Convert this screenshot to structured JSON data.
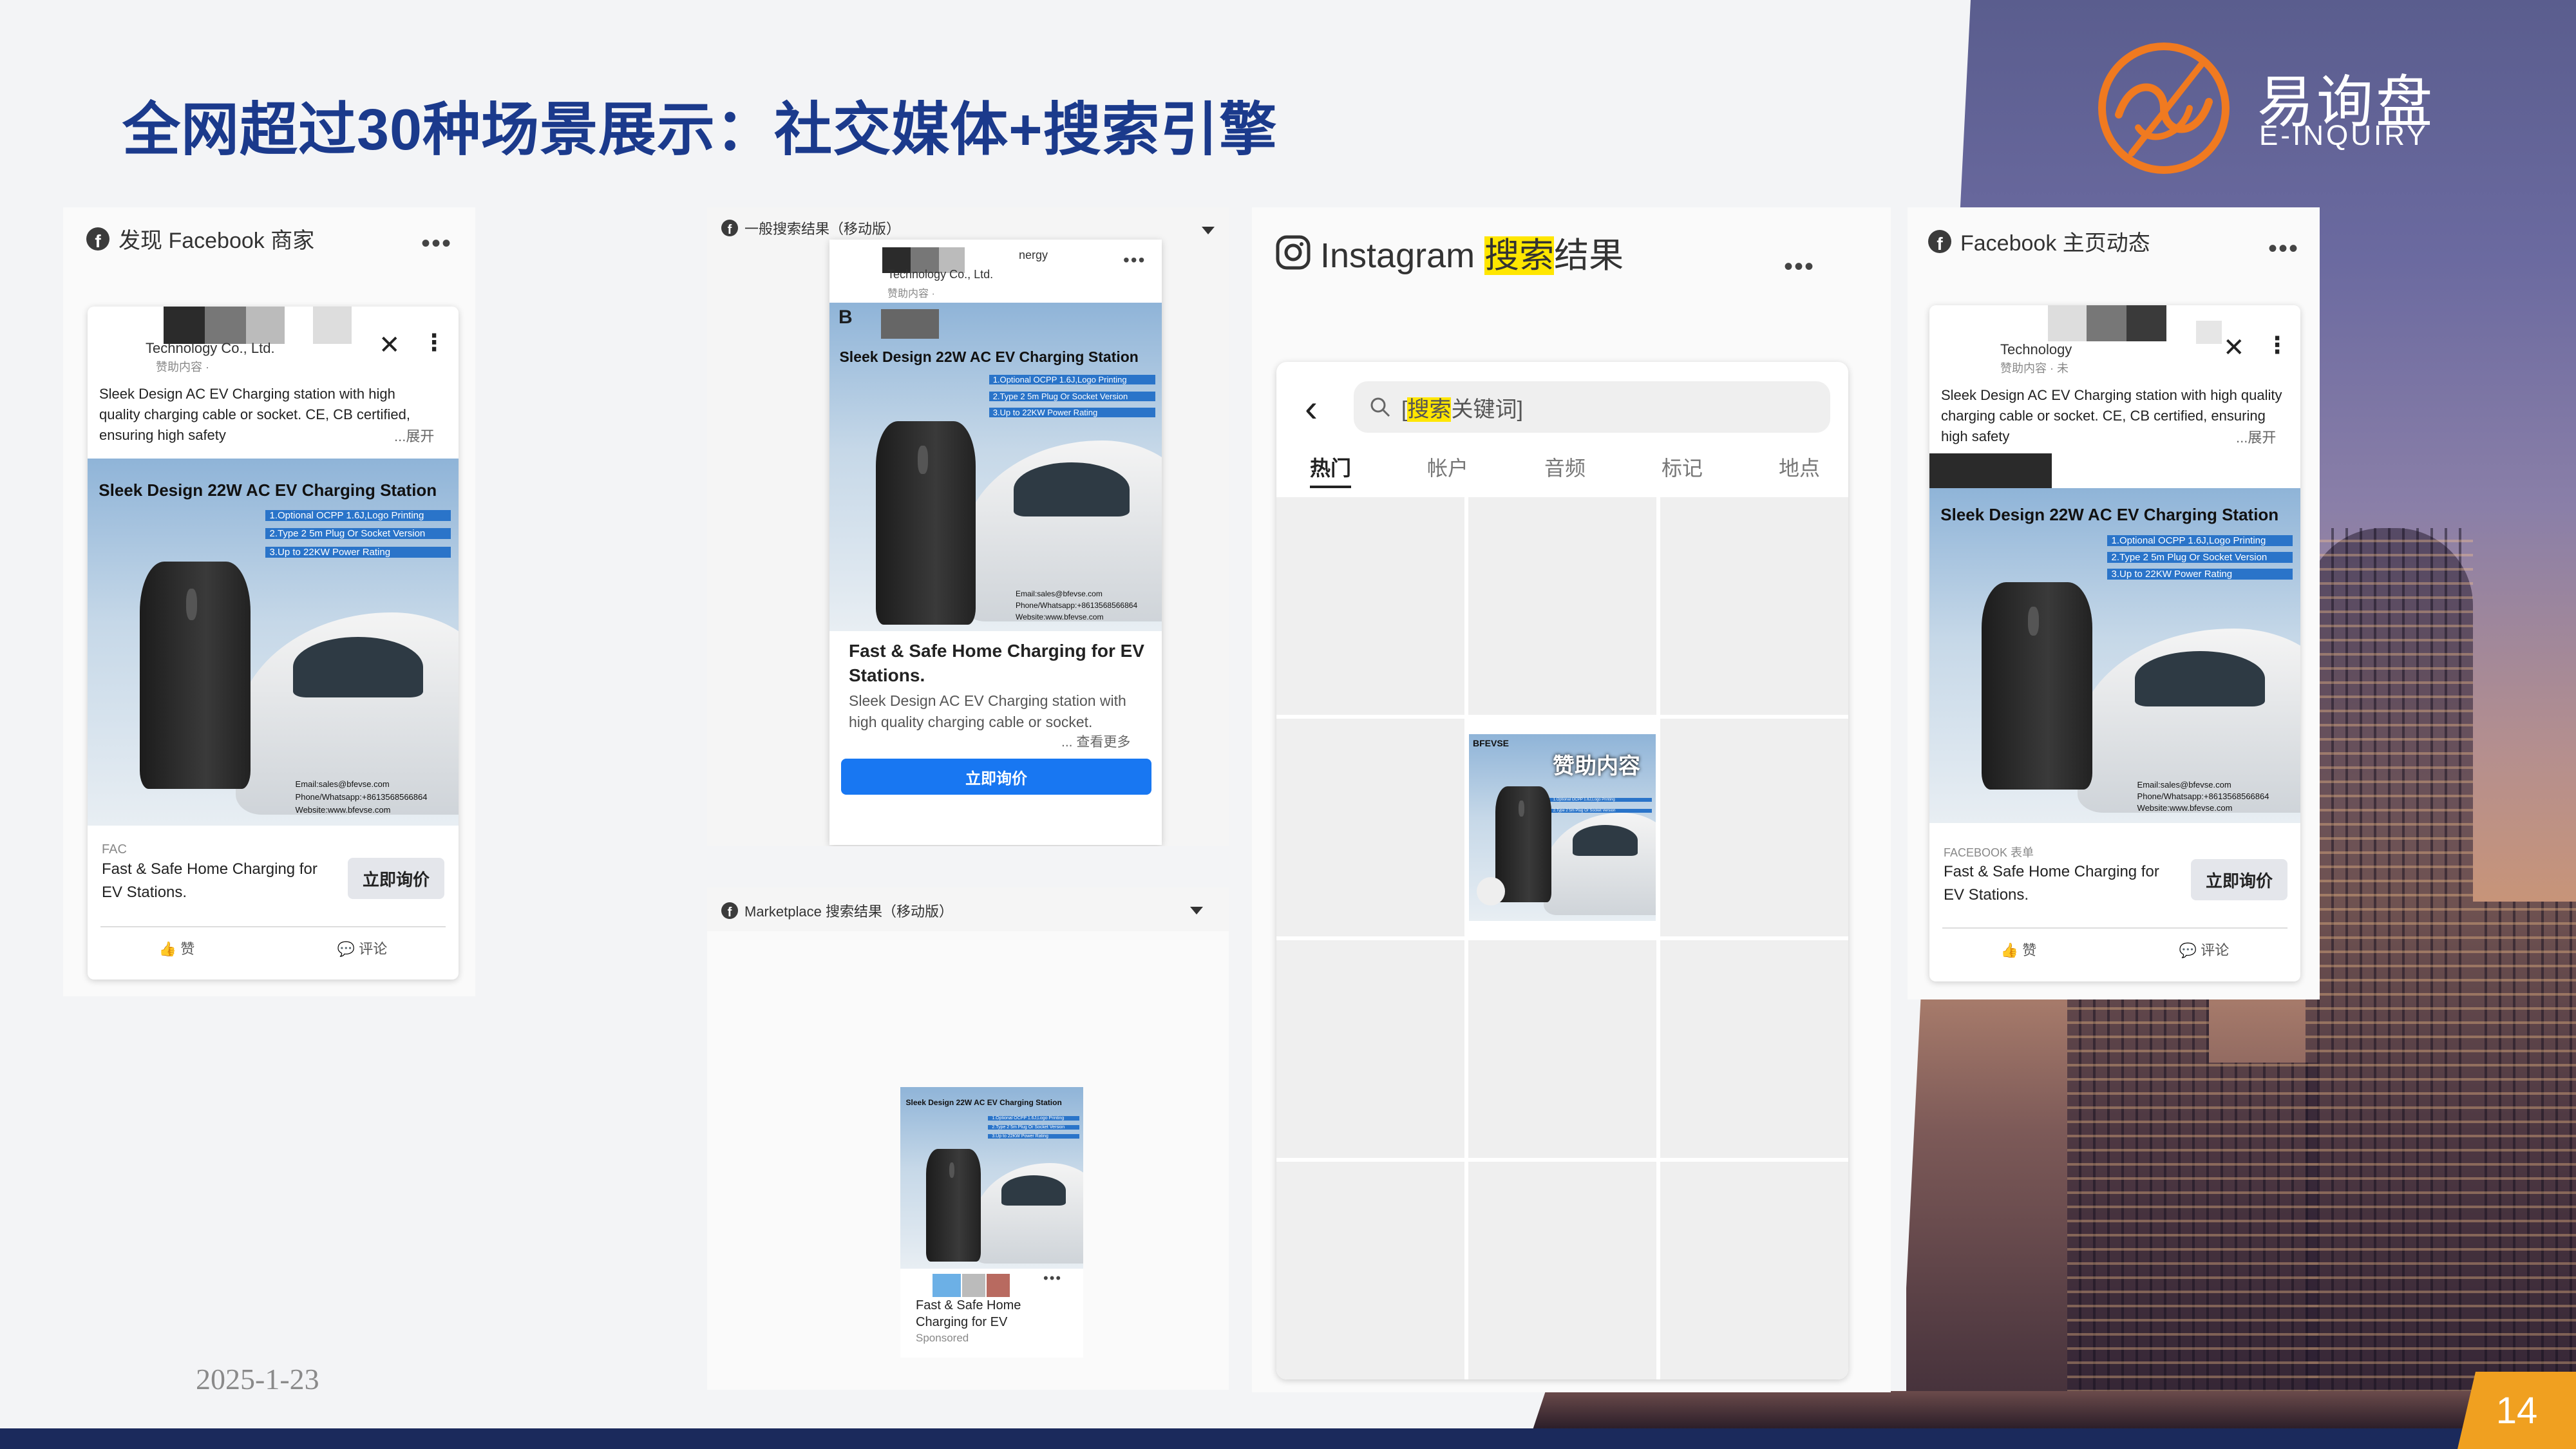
{
  "slide": {
    "title": "全网超过30种场景展示：社交媒体+搜索引擎",
    "date": "2025-1-23",
    "page_number": "14"
  },
  "logo": {
    "name_cn": "易询盘",
    "name_en": "E-INQUIRY",
    "color": "#f07a20"
  },
  "colors": {
    "title": "#1b3a8c",
    "bottom_bar": "#1b2a5c",
    "page_badge": "#f0a020",
    "facebook_blue": "#1877f2",
    "highlight": "#ffe600"
  },
  "fb_business": {
    "header": "发现 Facebook 商家",
    "company": "Technology Co., Ltd.",
    "sponsor": "赞助内容 · ",
    "post_text": "Sleek Design AC EV Charging station with high quality charging cable or socket. CE, CB certified, ensuring high safety",
    "more": "...展开",
    "cta_title": "Fast & Safe Home Charging for EV Stations.",
    "cta_source": "FAC",
    "cta_button": "立即询价",
    "like": "赞",
    "comment": "评论"
  },
  "product_image": {
    "title": "Sleek Design 22W AC EV Charging Station",
    "features": [
      "1.Optional OCPP 1.6J,Logo Printing",
      "2.Type 2 5m Plug Or Socket Version",
      "3.Up to 22KW Power Rating"
    ],
    "contact": [
      "Email:sales@bfevse.com",
      "Phone/Whatsapp:+8613568566864",
      "Website:www.bfevse.com"
    ]
  },
  "search_mobile": {
    "header": "一般搜索结果（移动版）",
    "company": "Technology Co., Ltd.",
    "company_tail": "nergy",
    "sponsor": "赞助内容 · ",
    "letter": "B",
    "cta_title": "Fast & Safe Home Charging for EV Stations.",
    "cta_desc": "Sleek Design AC EV Charging station with high quality charging cable or socket.",
    "more": "... 查看更多",
    "cta_button": "立即询价"
  },
  "marketplace": {
    "header": "Marketplace 搜索结果（移动版）",
    "item_title": "Fast & Safe Home Charging for EV",
    "item_sponsor": "Sponsored"
  },
  "instagram": {
    "header_prefix": "Instagram ",
    "header_highlight": "搜索",
    "header_suffix": "结果",
    "search_prefix": "[",
    "search_highlight": "搜索",
    "search_suffix": "关键词]",
    "tabs": [
      "热门",
      "帐户",
      "音频",
      "标记",
      "地点"
    ],
    "ad_label": "赞助内容",
    "ad_brand": "BFEVSE"
  },
  "fb_feed": {
    "header": "Facebook 主页动态",
    "company": "Technology",
    "sponsor": "赞助内容 · 未",
    "post_text": "Sleek Design AC EV Charging station with high quality charging cable or socket. CE, CB certified, ensuring high safety",
    "more": "...展开",
    "cta_source": "FACEBOOK 表单",
    "cta_title": "Fast & Safe Home Charging for EV Stations.",
    "cta_button": "立即询价",
    "like": "赞",
    "comment": "评论"
  }
}
